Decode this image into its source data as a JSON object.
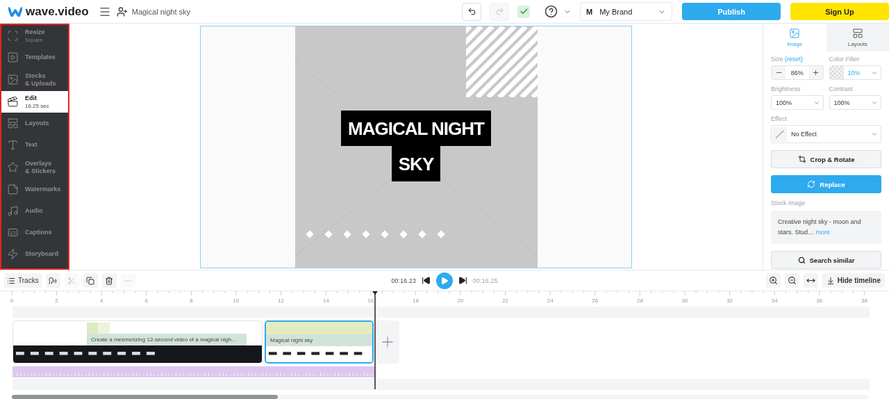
{
  "header": {
    "logo": "wave.video",
    "project_title": "Magical night sky",
    "tools": [
      {
        "kind": "undo",
        "disabled": false
      },
      {
        "kind": "redo",
        "disabled": true
      },
      {
        "kind": "saved"
      },
      {
        "kind": "help"
      }
    ],
    "brand": {
      "initial": "M",
      "name": "My Brand"
    },
    "publish": "Publish",
    "signup": "Sign Up"
  },
  "sidebar": {
    "items": [
      {
        "kind": "resize",
        "label": "Resize",
        "sublabel": "Square",
        "selected": false
      },
      {
        "kind": "templates",
        "label": "Templates",
        "selected": false
      },
      {
        "kind": "stocks",
        "label": "Stocks\n& Uploads",
        "selected": false
      },
      {
        "kind": "edit",
        "label": "Edit",
        "sublabel": "16.25 sec",
        "selected": true
      },
      {
        "kind": "layouts",
        "label": "Layouts",
        "selected": false
      },
      {
        "kind": "text",
        "label": "Text",
        "selected": false
      },
      {
        "kind": "overlays",
        "label": "Overlays\n& Stickers",
        "selected": false
      },
      {
        "kind": "watermarks",
        "label": "Watermarks",
        "selected": false
      },
      {
        "kind": "audio",
        "label": "Audio",
        "selected": false
      },
      {
        "kind": "captions",
        "label": "Captions",
        "selected": false
      },
      {
        "kind": "storyboard",
        "label": "Storyboard",
        "selected": false
      }
    ]
  },
  "canvas": {
    "title_lines": [
      "MAGICAL NIGHT",
      "SKY"
    ]
  },
  "panel": {
    "tabs": [
      {
        "kind": "image",
        "label": "Image",
        "selected": true
      },
      {
        "kind": "layouts",
        "label": "Layouts",
        "selected": false
      }
    ],
    "size": {
      "label": "Size",
      "link": "(reset)",
      "value": "86%"
    },
    "color_filter": {
      "label": "Color Filter",
      "value": "10%"
    },
    "brightness": {
      "label": "Brightness",
      "value": "100%"
    },
    "contrast": {
      "label": "Contrast",
      "value": "100%"
    },
    "effect": {
      "label": "Effect",
      "value": "No Effect"
    },
    "crop_button": "Crop & Rotate",
    "replace_button": "Replace",
    "stock_label": "Stock image",
    "stock_description": "Creative night sky - moon and stars. Stud…",
    "more_link": "more",
    "search_button": "Search similar"
  },
  "timeline": {
    "tools": [
      {
        "kind": "tracks",
        "label": "Tracks",
        "disabled": false
      },
      {
        "kind": "voice",
        "disabled": false
      },
      {
        "kind": "cut",
        "disabled": true
      },
      {
        "kind": "copy",
        "disabled": false
      },
      {
        "kind": "delete",
        "disabled": false
      },
      {
        "kind": "more",
        "disabled": true
      }
    ],
    "current_time": "00:16.23",
    "total_time": "00:16.25",
    "hide_label": "Hide timeline",
    "ruler": [
      "0",
      "2",
      "4",
      "6",
      "8",
      "10",
      "12",
      "14",
      "16",
      "18",
      "20",
      "22",
      "24",
      "26",
      "28",
      "30",
      "32",
      "34",
      "36",
      "38"
    ],
    "clips": [
      {
        "kind": "video",
        "label": "Create a mesmerizing 12-second video of a magical nigh…",
        "selected": false
      },
      {
        "kind": "image",
        "label": "Magical night sky",
        "selected": true
      }
    ]
  }
}
